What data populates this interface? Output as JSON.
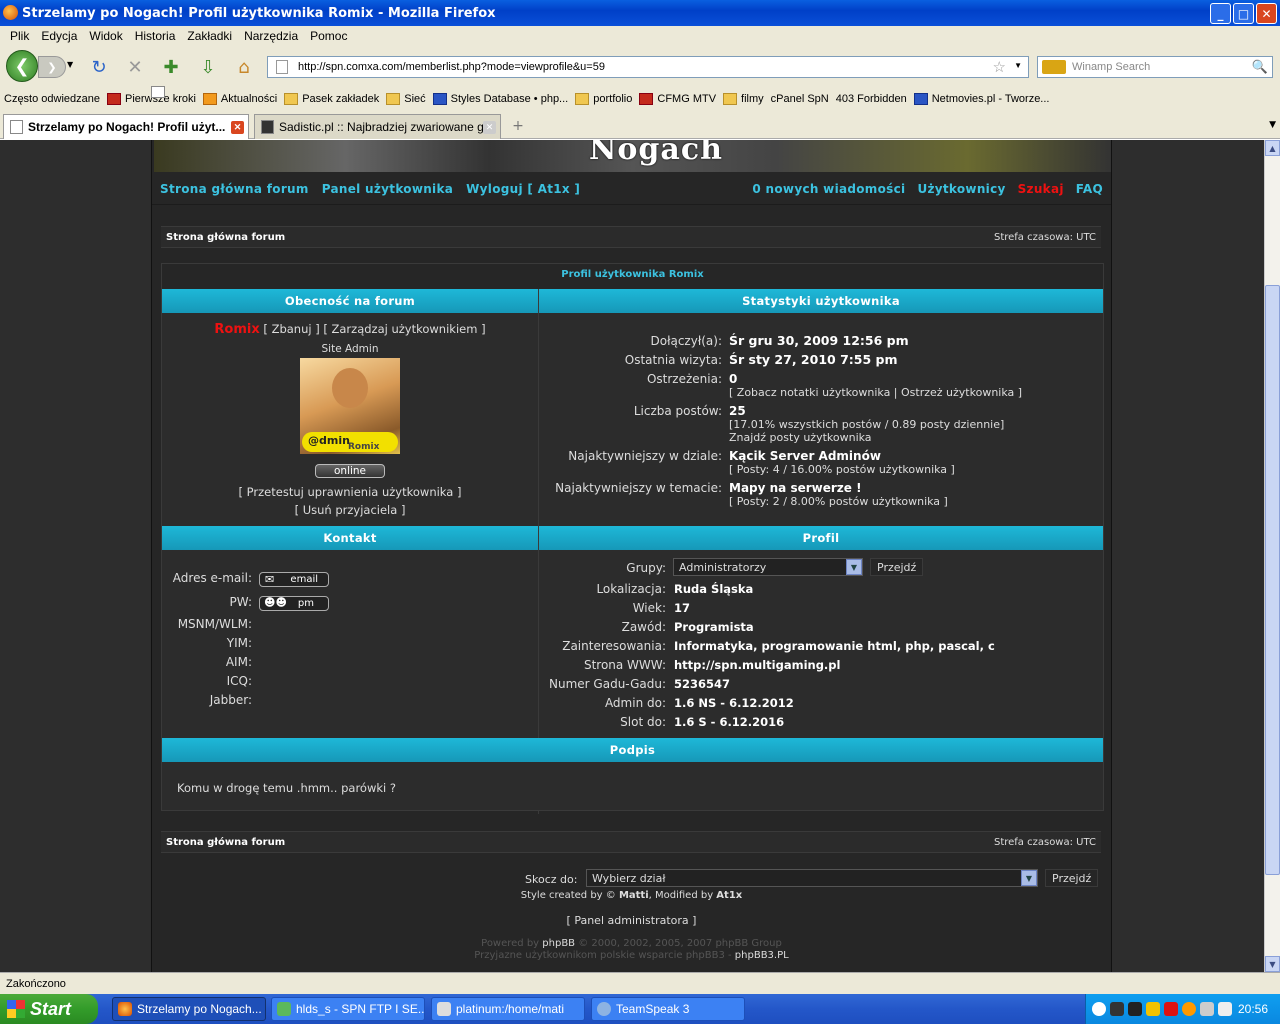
{
  "window": {
    "title": "Strzelamy po Nogach! Profil użytkownika Romix - Mozilla Firefox",
    "controls": [
      "_",
      "□",
      "✕"
    ]
  },
  "menu": [
    "Plik",
    "Edycja",
    "Widok",
    "Historia",
    "Zakładki",
    "Narzędzia",
    "Pomoc"
  ],
  "url": "http://spn.comxa.com/memberlist.php?mode=viewprofile&u=59",
  "search_placeholder": "Winamp Search",
  "bookmarks": [
    "Często odwiedzane",
    "Pierwsze kroki",
    "Aktualności",
    "Pasek zakładek",
    "Sieć",
    "Styles Database • php...",
    "portfolio",
    "CFMG MTV",
    "filmy",
    "cPanel SpN",
    "403 Forbidden",
    "Netmovies.pl - Tworze..."
  ],
  "tabs": [
    {
      "label": "Strzelamy po Nogach! Profil użyt..."
    },
    {
      "label": "Sadistic.pl :: Najbradziej zwariowane gify"
    }
  ],
  "banner_text": "Nogach",
  "topnav": {
    "left": [
      "Strona główna forum",
      "Panel użytkownika",
      "Wyloguj [ At1x ]"
    ],
    "right": [
      "0 nowych wiadomości",
      "Użytkownicy",
      "Szukaj",
      "FAQ"
    ]
  },
  "crumb": {
    "home": "Strona główna forum",
    "timezone": "Strefa czasowa: UTC"
  },
  "profile": {
    "title": "Profil użytkownika Romix",
    "presence_head": "Obecność na forum",
    "stats_head": "Statystyki użytkownika",
    "username": "Romix",
    "admin_links": "[ Zbanuj ] [ Zarządzaj użytkownikiem ]",
    "rank": "Site Admin",
    "avatar_text": "@dmin",
    "avatar_text2": "Romix",
    "status": "online",
    "test_perms": "[ Przetestuj uprawnienia użytkownika ]",
    "remove_friend": "[ Usuń przyjaciela ]",
    "stats": {
      "joined_label": "Dołączył(a):",
      "joined": "Śr gru 30, 2009 12:56 pm",
      "last_label": "Ostatnia wizyta:",
      "last": "Śr sty 27, 2010 7:55 pm",
      "warn_label": "Ostrzeżenia:",
      "warn": "0",
      "warn_links": "[ Zobacz notatki użytkownika | Ostrzeż użytkownika ]",
      "posts_label": "Liczba postów:",
      "posts": "25",
      "posts_pct": "[17.01% wszystkich postów / 0.89 posty dziennie]",
      "posts_find": "Znajdź posty użytkownika",
      "forum_label": "Najaktywniejszy w dziale:",
      "forum": "Kącik Server Adminów",
      "forum_sub": "[ Posty: 4 / 16.00% postów użytkownika ]",
      "topic_label": "Najaktywniejszy w temacie:",
      "topic": "Mapy na serwerze !",
      "topic_sub": "[ Posty: 2 / 8.00% postów użytkownika ]"
    },
    "contact_head": "Kontakt",
    "contact": {
      "email_label": "Adres e-mail:",
      "email_btn": "email",
      "pm_label": "PW:",
      "pm_btn": "pm",
      "msn_label": "MSNM/WLM:",
      "yim_label": "YIM:",
      "aim_label": "AIM:",
      "icq_label": "ICQ:",
      "jabber_label": "Jabber:"
    },
    "profile_head": "Profil",
    "details": {
      "groups_label": "Grupy:",
      "groups_value": "Administratorzy",
      "go": "Przejdź",
      "loc_label": "Lokalizacja:",
      "loc": "Ruda Śląska",
      "age_label": "Wiek:",
      "age": "17",
      "job_label": "Zawód:",
      "job": "Programista",
      "int_label": "Zainteresowania:",
      "int": "Informatyka, programowanie html, php, pascal, c",
      "www_label": "Strona WWW:",
      "www": "http://spn.multigaming.pl",
      "gg_label": "Numer Gadu-Gadu:",
      "gg": "5236547",
      "admin_label": "Admin do:",
      "admin": "1.6 NS - 6.12.2012",
      "slot_label": "Slot do:",
      "slot": "1.6 S - 6.12.2016"
    },
    "signature_head": "Podpis",
    "signature": "Komu w drogę temu .hmm.. parówki ?"
  },
  "footer": {
    "home": "Strona główna forum",
    "timezone": "Strefa czasowa: UTC",
    "jump_label": "Skocz do:",
    "jump_value": "Wybierz dział",
    "jump_go": "Przejdź",
    "style_prefix": "Style created by © ",
    "style_author": "Matti",
    "style_mid": ", Modified by ",
    "style_mod": "At1x",
    "admin_panel": "[ Panel administratora ]",
    "powered_prefix": "Powered by ",
    "powered_link": "phpBB",
    "powered_suffix": " © 2000, 2002, 2005, 2007 phpBB Group",
    "support_prefix": "Przyjazne użytkownikom polskie wsparcie phpBB3 - ",
    "support_link": "phpBB3.PL"
  },
  "statusbar": "Zakończono",
  "taskbar": {
    "start": "Start",
    "items": [
      "Strzelamy po Nogach...",
      "hlds_s - SPN FTP I SE...",
      "platinum:/home/mati",
      "TeamSpeak 3"
    ],
    "clock": "20:56"
  }
}
